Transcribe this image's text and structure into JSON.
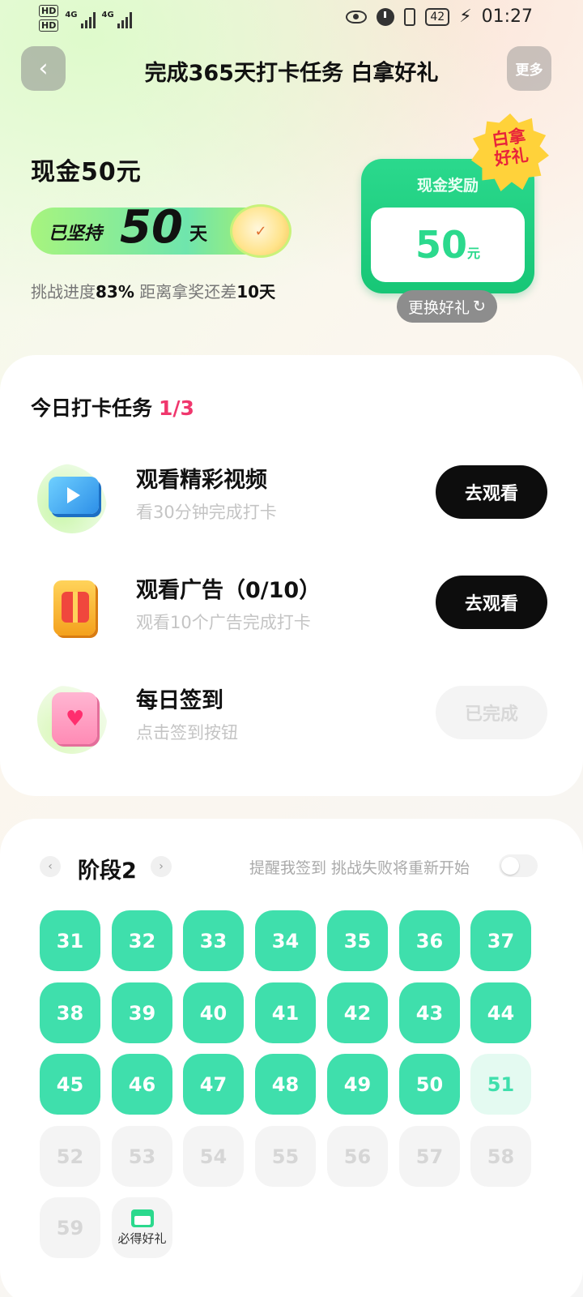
{
  "status": {
    "time": "01:27",
    "battery": "42",
    "net1": "4G",
    "net2": "4G",
    "hd1": "HD",
    "hd2": "HD"
  },
  "header": {
    "title": "完成365天打卡任务 白拿好礼",
    "back_icon": "chevron-left-icon",
    "more_label": "更多"
  },
  "hero": {
    "cash_title": "现金50元",
    "streak_prefix": "已坚持",
    "streak_days": "50",
    "streak_suffix": "天",
    "progress_label": "挑战进度",
    "progress_value": "83%",
    "remaining_label": "距离拿奖还差",
    "remaining_value": "10天",
    "progress_fraction": 0.83
  },
  "prize": {
    "label": "现金奖励",
    "amount": "50",
    "unit": "元",
    "badge_line1": "白拿",
    "badge_line2": "好礼",
    "swap_label": "更换好礼",
    "swap_icon": "refresh-icon",
    "accent_color": "#2bd98d"
  },
  "tasks": {
    "title": "今日打卡任务",
    "count": "1/3",
    "items": [
      {
        "name": "观看精彩视频",
        "desc": "看30分钟完成打卡",
        "button": "去观看",
        "icon": "video-play-icon",
        "done": false
      },
      {
        "name": "观看广告（0/10）",
        "desc": "观看10个广告完成打卡",
        "button": "去观看",
        "icon": "gift-box-icon",
        "done": false
      },
      {
        "name": "每日签到",
        "desc": "点击签到按钮",
        "button": "已完成",
        "icon": "calendar-heart-icon",
        "done": true
      }
    ]
  },
  "calendar": {
    "stage": "阶段2",
    "remind_text": "提醒我签到 挑战失败将重新开始",
    "reminder_on": false,
    "days_done": [
      "31",
      "32",
      "33",
      "34",
      "35",
      "36",
      "37",
      "38",
      "39",
      "40",
      "41",
      "42",
      "43",
      "44",
      "45",
      "46",
      "47",
      "48",
      "49",
      "50"
    ],
    "day_today": "51",
    "days_future": [
      "52",
      "53",
      "54",
      "55",
      "56",
      "57",
      "58",
      "59"
    ],
    "gift_label": "必得好礼",
    "done_color": "#3fdfac"
  }
}
